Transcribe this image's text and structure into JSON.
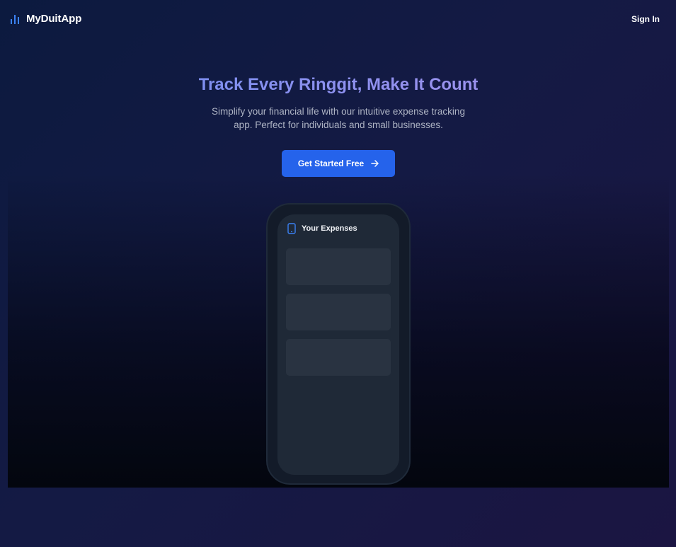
{
  "navbar": {
    "brand_name": "MyDuitApp",
    "brand_icon": "bar-chart-icon",
    "signin_label": "Sign In"
  },
  "hero": {
    "headline": "Track Every Ringgit, Make It Count",
    "subtitle": "Simplify your financial life with our intuitive expense tracking app. Perfect for individuals and small businesses.",
    "cta_label": "Get Started Free",
    "cta_icon": "arrow-right-icon"
  },
  "phone_mockup": {
    "icon": "smartphone-icon",
    "title": "Your Expenses"
  },
  "colors": {
    "accent": "#2563eb",
    "headline_start": "#7f8ff0",
    "headline_end": "#9b92ee",
    "background_start": "#0c1a3f",
    "background_end": "#1b1542",
    "phone_screen": "#1f2937",
    "card": "#293341"
  }
}
